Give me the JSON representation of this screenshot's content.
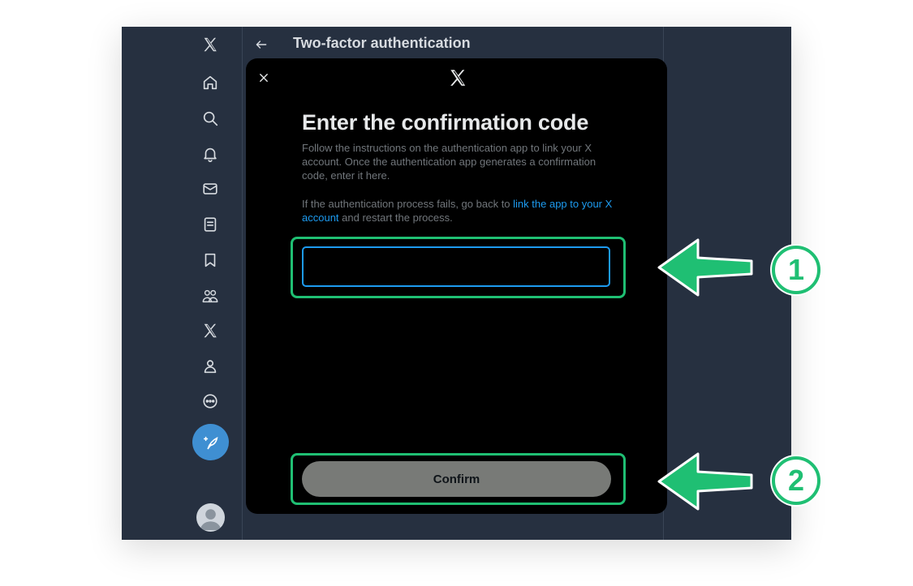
{
  "header": {
    "title": "Two-factor authentication"
  },
  "sidebar": {
    "items": [
      {
        "icon": "x-logo-icon"
      },
      {
        "icon": "home-icon"
      },
      {
        "icon": "search-icon"
      },
      {
        "icon": "bell-icon"
      },
      {
        "icon": "mail-icon"
      },
      {
        "icon": "lists-icon"
      },
      {
        "icon": "bookmark-icon"
      },
      {
        "icon": "communities-icon"
      },
      {
        "icon": "premium-x-icon"
      },
      {
        "icon": "profile-icon"
      },
      {
        "icon": "more-icon"
      }
    ],
    "compose_icon": "compose-feather-icon",
    "avatar_icon": "avatar-icon"
  },
  "modal": {
    "title": "Enter the confirmation code",
    "description": "Follow the instructions on the authentication app to link your X account. Once the authentication app generates a confirmation code, enter it here.",
    "fail_prefix": "If the authentication process fails, go back to ",
    "fail_link": "link the app to your X account",
    "fail_suffix": " and restart the process.",
    "code_value": "",
    "confirm_label": "Confirm"
  },
  "annotations": {
    "step1": "1",
    "step2": "2",
    "accent_color": "#1fbf73"
  },
  "colors": {
    "app_bg": "#263040",
    "modal_bg": "#000000",
    "link": "#1d9bf0",
    "button_disabled": "#787a77"
  }
}
